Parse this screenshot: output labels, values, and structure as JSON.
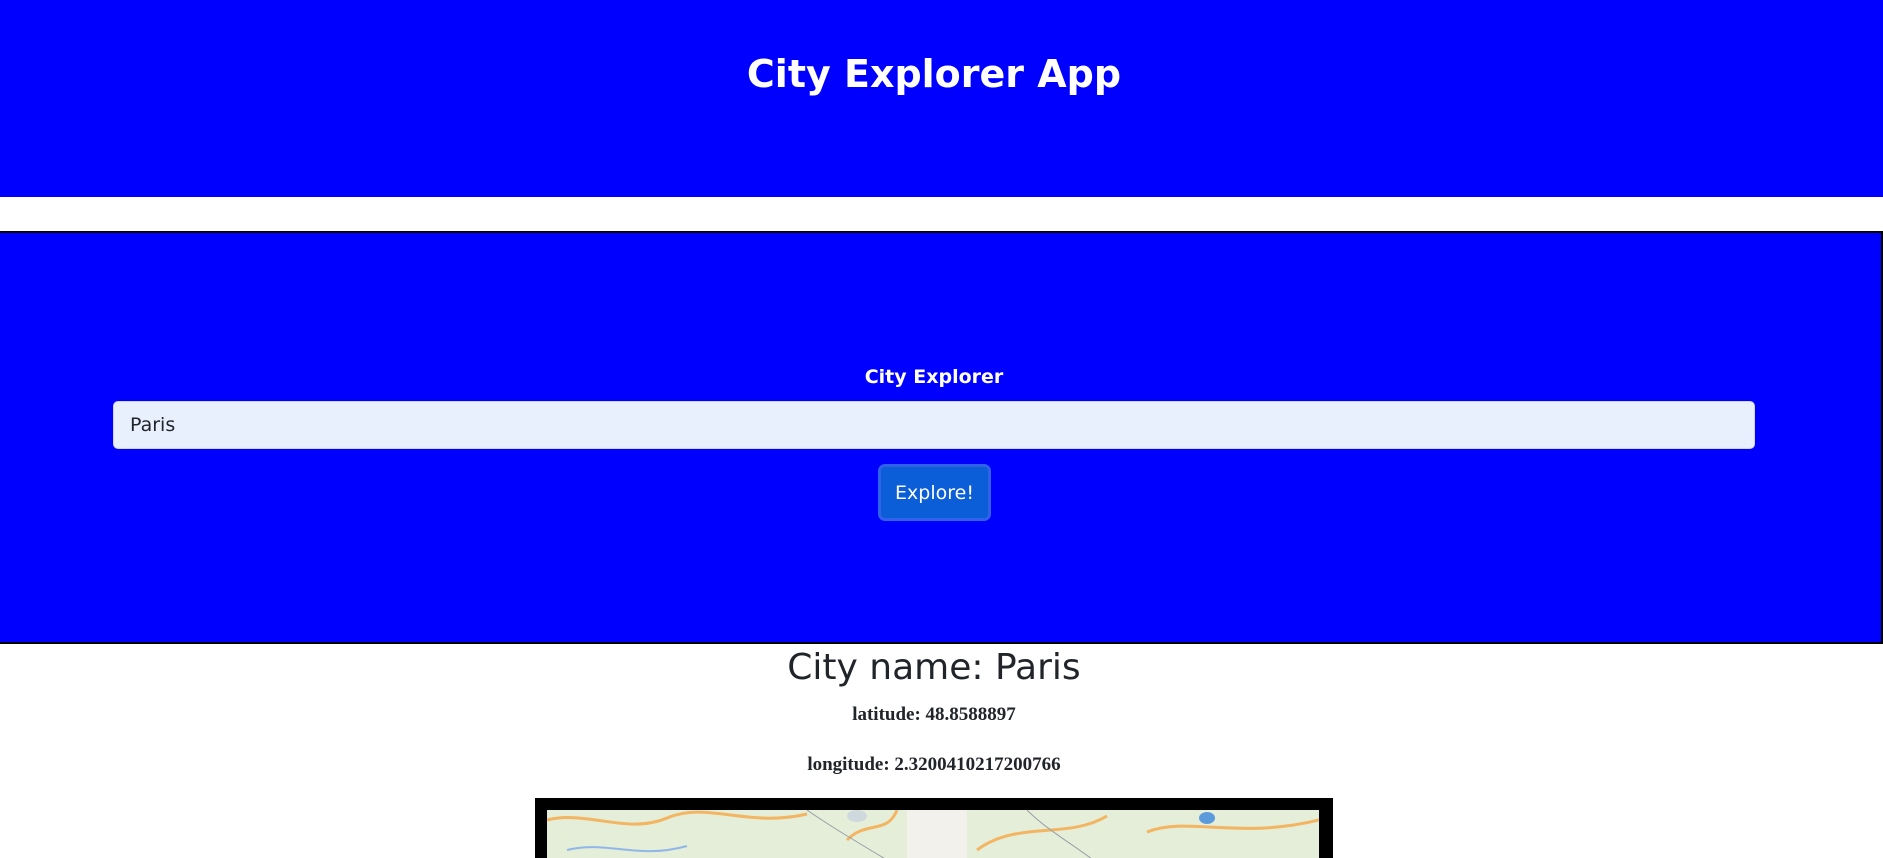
{
  "header": {
    "title": "City Explorer App"
  },
  "search_form": {
    "label": "City Explorer",
    "input_value": "Paris",
    "button_label": "Explore!"
  },
  "result": {
    "city_name": "City name: Paris",
    "latitude": "latitude: 48.8588897",
    "longitude": "longitude: 2.3200410217200766"
  },
  "colors": {
    "header_background": "#0000ff",
    "panel_background": "#0000ff",
    "input_background": "#e8f0fe",
    "button_background": "#0b5ed7",
    "map_frame": "#000000"
  },
  "icons": {
    "map": "map-image"
  }
}
